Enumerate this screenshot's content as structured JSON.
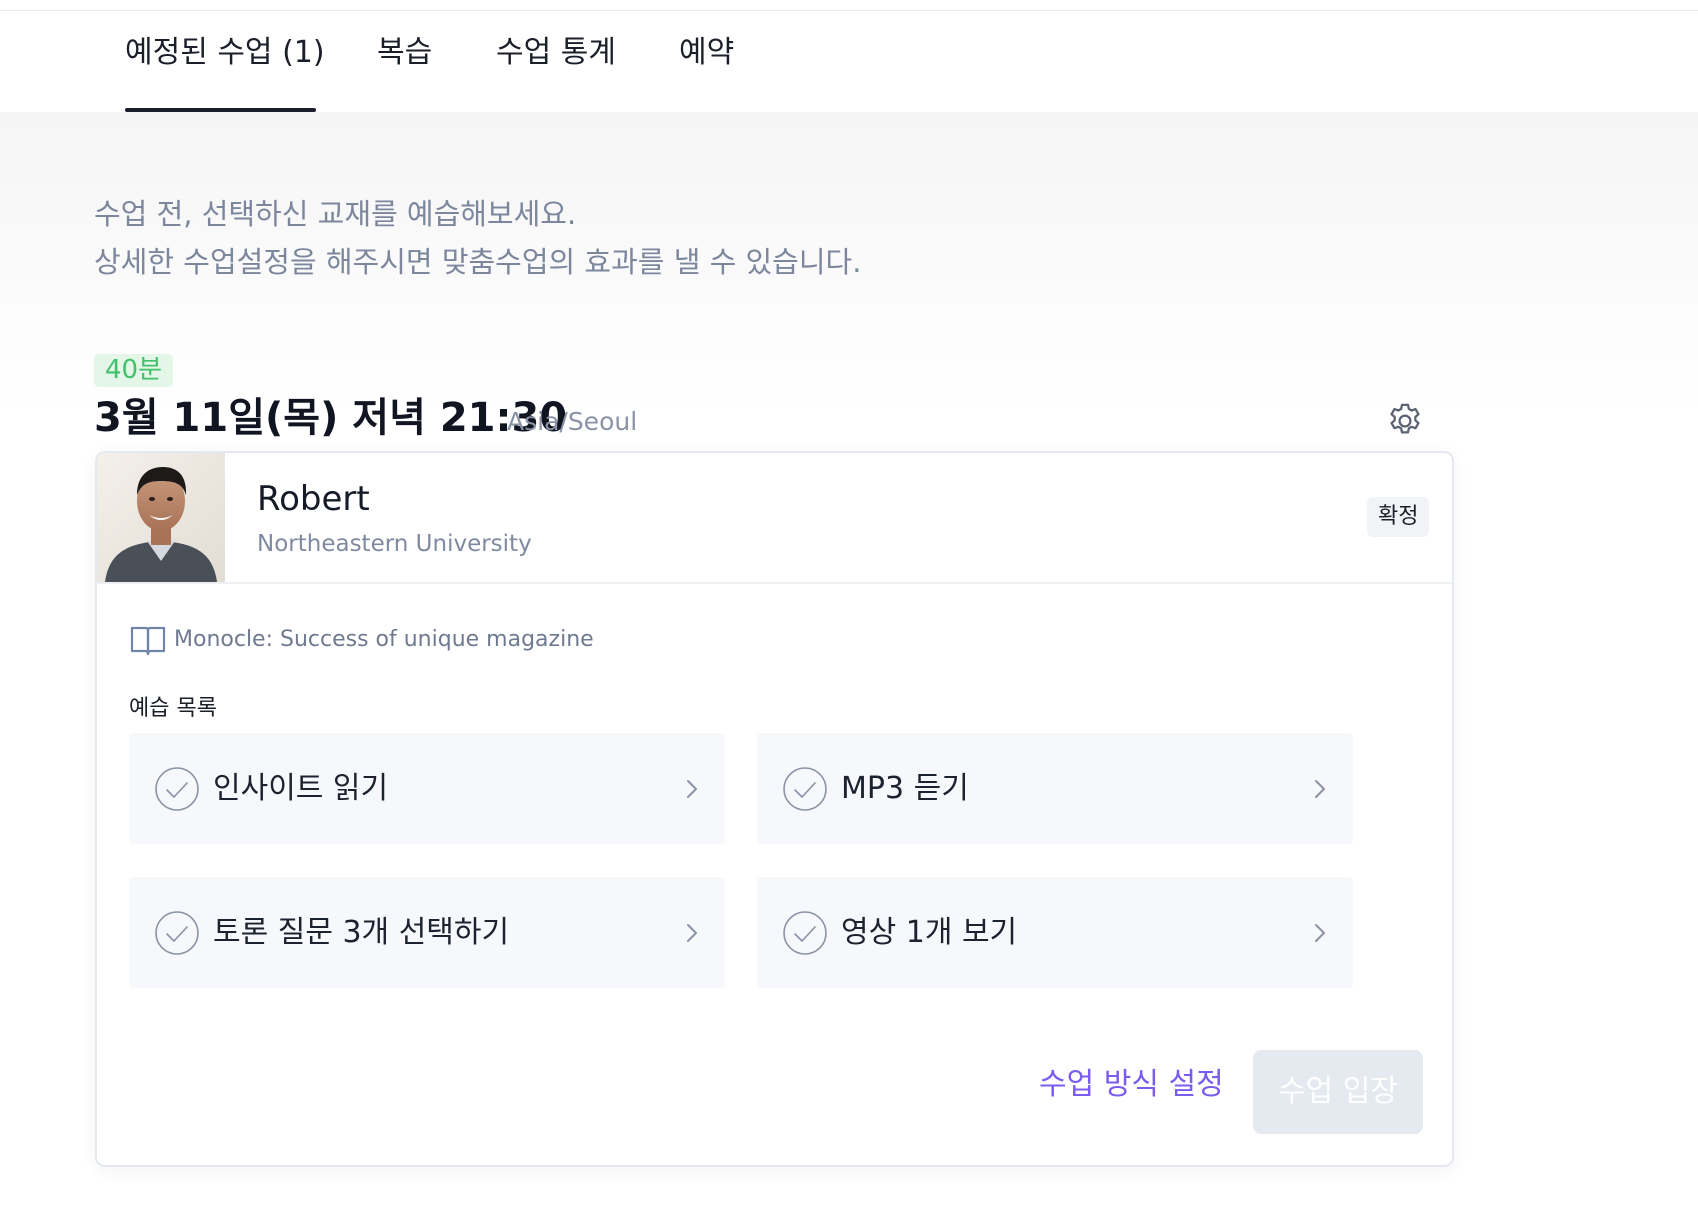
{
  "tabs": [
    {
      "label": "예정된 수업 (1)",
      "active": true
    },
    {
      "label": "복습",
      "active": false
    },
    {
      "label": "수업 통계",
      "active": false
    },
    {
      "label": "예약",
      "active": false
    }
  ],
  "intro": {
    "line1": "수업 전, 선택하신 교재를 예습해보세요.",
    "line2": "상세한 수업설정을 해주시면 맞춤수업의 효과를 낼 수 있습니다."
  },
  "lesson": {
    "duration": "40분",
    "datetime": "3월 11일(목) 저녁 21:30",
    "timezone": "Asia/Seoul",
    "settings_icon": "gear-icon",
    "teacher": {
      "name": "Robert",
      "school": "Northeastern University",
      "status": "확정"
    },
    "material": {
      "icon": "book-icon",
      "title": "Monocle: Success of unique magazine"
    },
    "prep_heading": "예습 목록",
    "prep_items": [
      {
        "label": "인사이트 읽기",
        "icon": "check-circle-icon"
      },
      {
        "label": "MP3 듣기",
        "icon": "check-circle-icon"
      },
      {
        "label": "토론 질문 3개 선택하기",
        "icon": "check-circle-icon"
      },
      {
        "label": "영상 1개 보기",
        "icon": "check-circle-icon"
      }
    ],
    "settings_link": "수업 방식 설정",
    "enter_button": "수업 입장"
  },
  "colors": {
    "accent": "#7a5cf0",
    "duration_badge_bg": "#e4f6e8",
    "duration_badge_text": "#42c16a",
    "disabled_button_bg": "#e5e9f0"
  }
}
